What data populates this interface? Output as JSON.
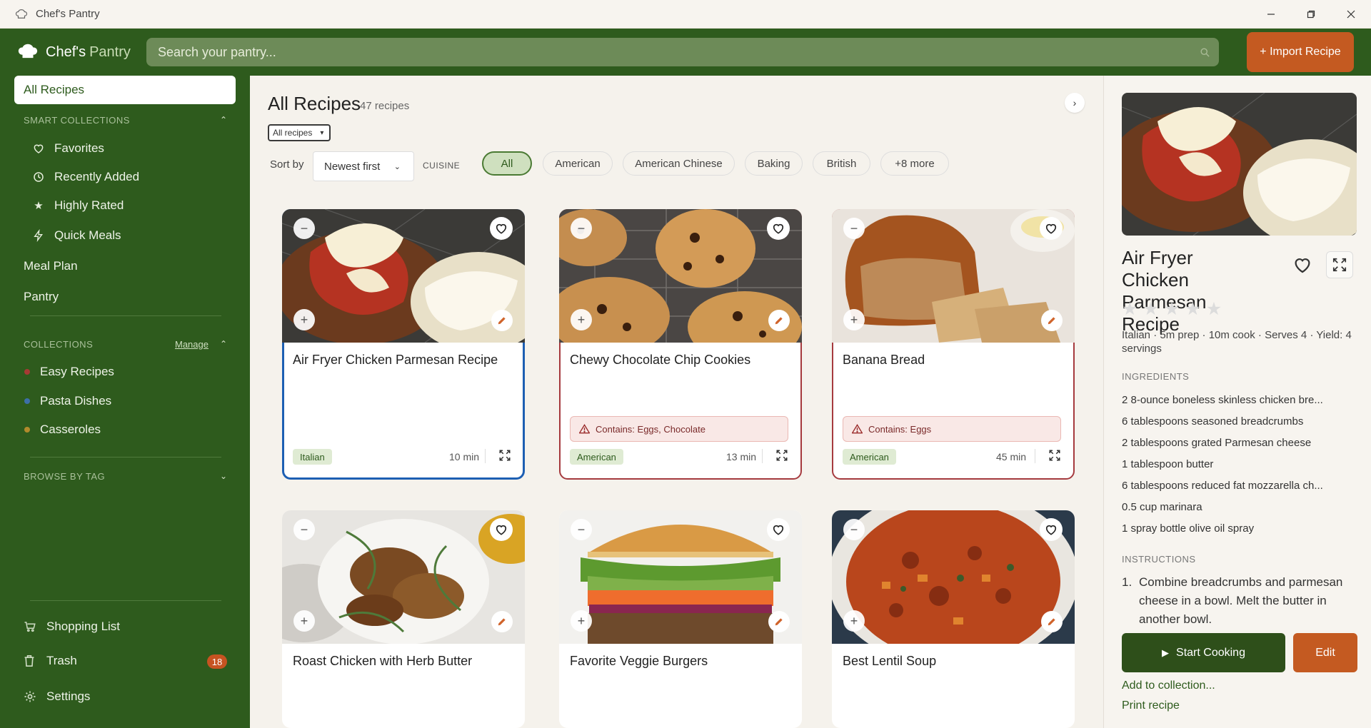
{
  "window": {
    "title": "Chef's Pantry",
    "controls": [
      "minimize-icon",
      "restore-icon",
      "close-icon"
    ]
  },
  "brand": {
    "part1": "Chef's",
    "part2": "Pantry"
  },
  "search": {
    "placeholder": "Search your pantry...",
    "value": ""
  },
  "import_label": "+ Import Recipe",
  "sidebar": {
    "all_recipes": "All Recipes",
    "smart_title": "SMART COLLECTIONS",
    "smart_items": [
      {
        "label": "Favorites",
        "icon": "heart-icon"
      },
      {
        "label": "Recently Added",
        "icon": "clock-icon"
      },
      {
        "label": "Highly Rated",
        "icon": "star-icon"
      },
      {
        "label": "Quick Meals",
        "icon": "bolt-icon"
      }
    ],
    "meal_plan": "Meal Plan",
    "pantry": "Pantry",
    "collections_title": "COLLECTIONS",
    "manage": "Manage",
    "collections": [
      {
        "label": "Easy Recipes",
        "color": "#a63a34"
      },
      {
        "label": "Pasta Dishes",
        "color": "#3d6fa8"
      },
      {
        "label": "Casseroles",
        "color": "#b18a2c"
      }
    ],
    "browse_title": "BROWSE BY TAG",
    "shopping": "Shopping List",
    "trash": "Trash",
    "trash_count": "18",
    "settings": "Settings"
  },
  "main": {
    "title": "All Recipes",
    "count": "47 recipes",
    "filter": "All recipes",
    "sort_label": "Sort by",
    "sort_value": "Newest first",
    "cuisine_label": "CUISINE",
    "chips": [
      "All",
      "American",
      "American Chinese",
      "Baking",
      "British",
      "+8 more"
    ]
  },
  "cards": [
    {
      "title": "Air Fryer Chicken Parmesan Recipe",
      "tag": "Italian",
      "time": "10 min",
      "allergen": ""
    },
    {
      "title": "Chewy Chocolate Chip Cookies",
      "tag": "American",
      "time": "13 min",
      "allergen": "Contains: Eggs, Chocolate"
    },
    {
      "title": "Banana Bread",
      "tag": "American",
      "time": "45 min",
      "allergen": "Contains: Eggs"
    },
    {
      "title": "Roast Chicken with Herb Butter"
    },
    {
      "title": "Favorite Veggie Burgers"
    },
    {
      "title": "Best Lentil Soup"
    }
  ],
  "detail": {
    "title": "Air Fryer Chicken Parmesan Recipe",
    "rating": 0,
    "meta": "Italian · 5m prep · 10m cook · Serves 4 · Yield: 4 servings",
    "ingredients_title": "INGREDIENTS",
    "ingredients": [
      "2 8-ounce boneless skinless chicken bre...",
      "6 tablespoons seasoned breadcrumbs",
      "2 tablespoons grated Parmesan cheese",
      "1 tablespoon butter",
      "6 tablespoons reduced fat mozzarella ch...",
      "0.5 cup marinara",
      "1 spray bottle olive oil spray"
    ],
    "instructions_title": "INSTRUCTIONS",
    "instruction_num": "1.",
    "instruction_1": "Combine breadcrumbs and parmesan cheese in a bowl. Melt the butter in another bowl.",
    "start_label": "Start Cooking",
    "edit_label": "Edit",
    "add_collection": "Add to collection...",
    "print": "Print recipe"
  }
}
